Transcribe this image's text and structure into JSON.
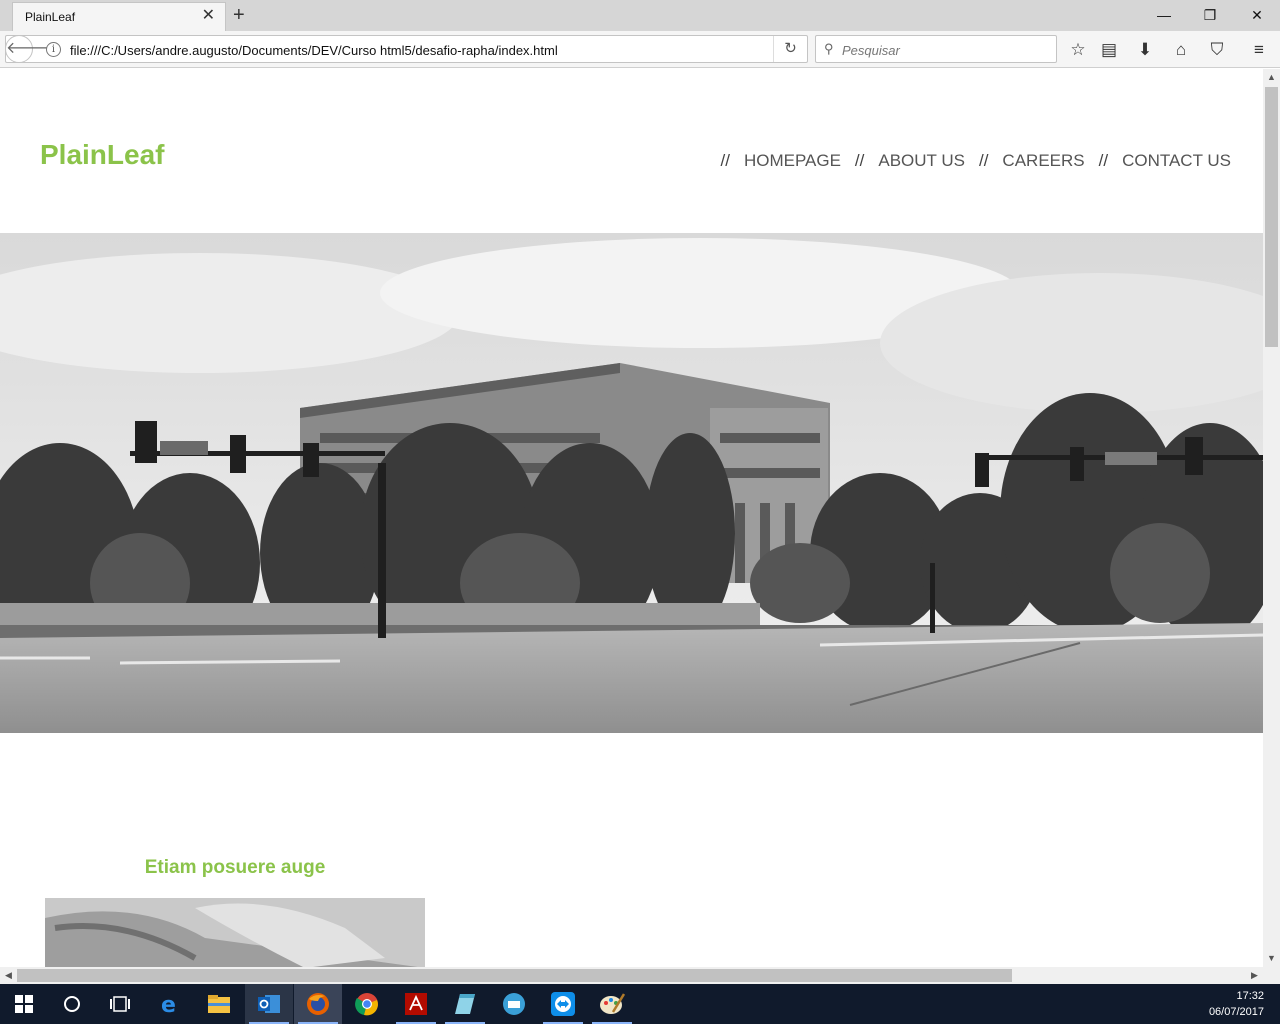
{
  "browser": {
    "tab_title": "PlainLeaf",
    "url": "file:///C:/Users/andre.augusto/Documents/DEV/Curso html5/desafio-rapha/index.html",
    "search_placeholder": "Pesquisar"
  },
  "page": {
    "logo": "PlainLeaf",
    "nav_separator": "//",
    "nav": [
      "HOMEPAGE",
      "ABOUT US",
      "CAREERS",
      "CONTACT US"
    ],
    "section_title": "Etiam posuere auge",
    "brand_color": "#8bc34a"
  },
  "taskbar": {
    "time": "17:32",
    "date": "06/07/2017",
    "apps": [
      "windows-start",
      "cortana",
      "task-view",
      "edge",
      "file-explorer",
      "outlook",
      "firefox",
      "chrome",
      "acrobat",
      "notepad",
      "remote-app",
      "teamviewer",
      "paint"
    ]
  }
}
